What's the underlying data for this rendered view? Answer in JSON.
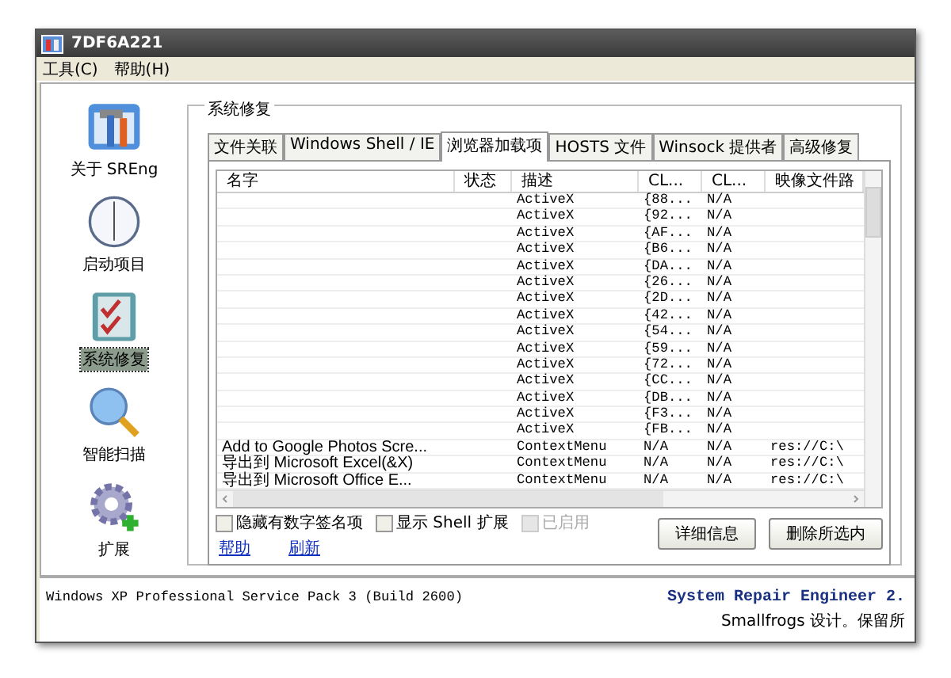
{
  "window": {
    "title": "7DF6A221"
  },
  "menu": [
    "工具(C)",
    "帮助(H)"
  ],
  "sidebar": {
    "items": [
      {
        "label": "关于 SREng",
        "selected": false
      },
      {
        "label": "启动项目",
        "selected": false
      },
      {
        "label": "系统修复",
        "selected": true
      },
      {
        "label": "智能扫描",
        "selected": false
      },
      {
        "label": "扩展",
        "selected": false
      }
    ]
  },
  "group": {
    "title": "系统修复"
  },
  "tabs": [
    {
      "label": "文件关联",
      "selected": false
    },
    {
      "label": "Windows Shell / IE",
      "selected": false
    },
    {
      "label": "浏览器加载项",
      "selected": true
    },
    {
      "label": "HOSTS 文件",
      "selected": false
    },
    {
      "label": "Winsock 提供者",
      "selected": false
    },
    {
      "label": "高级修复",
      "selected": false
    }
  ],
  "table": {
    "columns": [
      "名字",
      "状态",
      "描述",
      "CL...",
      "CL...",
      "映像文件路"
    ],
    "rows": [
      [
        "",
        "",
        "ActiveX",
        "{88...",
        "N/A",
        ""
      ],
      [
        "",
        "",
        "ActiveX",
        "{92...",
        "N/A",
        ""
      ],
      [
        "",
        "",
        "ActiveX",
        "{AF...",
        "N/A",
        ""
      ],
      [
        "",
        "",
        "ActiveX",
        "{B6...",
        "N/A",
        ""
      ],
      [
        "",
        "",
        "ActiveX",
        "{DA...",
        "N/A",
        ""
      ],
      [
        "",
        "",
        "ActiveX",
        "{26...",
        "N/A",
        ""
      ],
      [
        "",
        "",
        "ActiveX",
        "{2D...",
        "N/A",
        ""
      ],
      [
        "",
        "",
        "ActiveX",
        "{42...",
        "N/A",
        ""
      ],
      [
        "",
        "",
        "ActiveX",
        "{54...",
        "N/A",
        ""
      ],
      [
        "",
        "",
        "ActiveX",
        "{59...",
        "N/A",
        ""
      ],
      [
        "",
        "",
        "ActiveX",
        "{72...",
        "N/A",
        ""
      ],
      [
        "",
        "",
        "ActiveX",
        "{CC...",
        "N/A",
        ""
      ],
      [
        "",
        "",
        "ActiveX",
        "{DB...",
        "N/A",
        ""
      ],
      [
        "",
        "",
        "ActiveX",
        "{F3...",
        "N/A",
        ""
      ],
      [
        "",
        "",
        "ActiveX",
        "{FB...",
        "N/A",
        ""
      ],
      [
        "Add to Google Photos Scre...",
        "",
        "ContextMenu",
        "N/A",
        "N/A",
        "res://C:\\"
      ],
      [
        "导出到 Microsoft Excel(&X)",
        "",
        "ContextMenu",
        "N/A",
        "N/A",
        "res://C:\\"
      ],
      [
        "导出到 Microsoft Office E...",
        "",
        "ContextMenu",
        "N/A",
        "N/A",
        "res://C:\\"
      ]
    ]
  },
  "options": [
    {
      "label": "隐藏有数字签名项",
      "checked": false,
      "disabled": false
    },
    {
      "label": "显示 Shell 扩展",
      "checked": false,
      "disabled": false
    },
    {
      "label": "已启用",
      "checked": false,
      "disabled": true
    }
  ],
  "links": [
    "帮助",
    "刷新"
  ],
  "buttons": [
    "详细信息",
    "删除所选内"
  ],
  "status_bar": {
    "os": "Windows XP Professional Service Pack 3 (Build 2600)",
    "product": "System Repair Engineer 2.",
    "credit": "Smallfrogs 设计。保留所"
  }
}
